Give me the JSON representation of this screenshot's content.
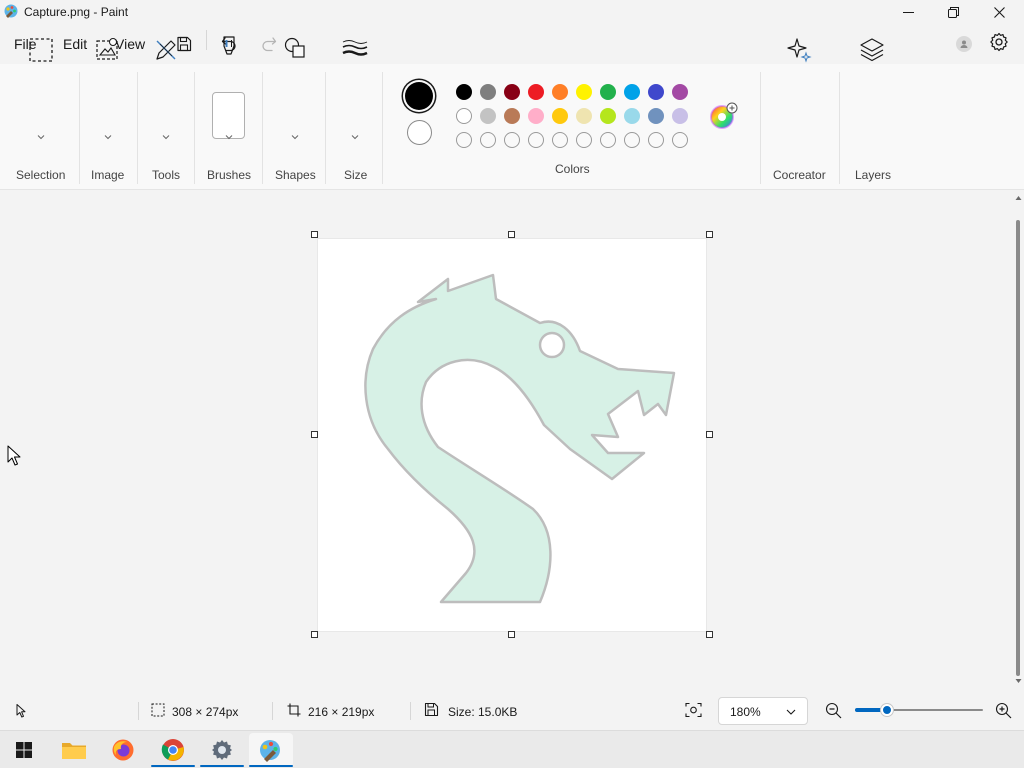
{
  "window": {
    "title": "Capture.png - Paint"
  },
  "menu": {
    "file": "File",
    "edit": "Edit",
    "view": "View"
  },
  "ribbon": {
    "groups": {
      "selection": "Selection",
      "image": "Image",
      "tools": "Tools",
      "brushes": "Brushes",
      "shapes": "Shapes",
      "size": "Size",
      "colors": "Colors",
      "cocreator": "Cocreator",
      "layers": "Layers"
    },
    "primary_color": "#000000",
    "secondary_color": "#ffffff",
    "palette_row1": [
      "#000000",
      "#7f7f7f",
      "#880015",
      "#ed1c24",
      "#ff7f27",
      "#fff200",
      "#22b14c",
      "#00a2e8",
      "#3f48cc",
      "#a349a4"
    ],
    "palette_row2": [
      "#ffffff",
      "#c3c3c3",
      "#b97a57",
      "#ffaec9",
      "#ffc90e",
      "#efe4b0",
      "#b5e61d",
      "#99d9ea",
      "#7092be",
      "#c8bfe7"
    ],
    "palette_row3_empty_count": 10
  },
  "canvas": {
    "drawing": "dragon-head-logo",
    "fill_color": "#d7f1e6",
    "outline_color": "#bdbdbd"
  },
  "status": {
    "cursor_position": "",
    "selection_size": "308 × 274px",
    "canvas_size": "216 × 219px",
    "file_size": "Size: 15.0KB",
    "zoom": "180%"
  },
  "taskbar": {
    "apps": [
      "start-button",
      "file-explorer",
      "firefox",
      "chrome",
      "settings",
      "paint"
    ]
  }
}
